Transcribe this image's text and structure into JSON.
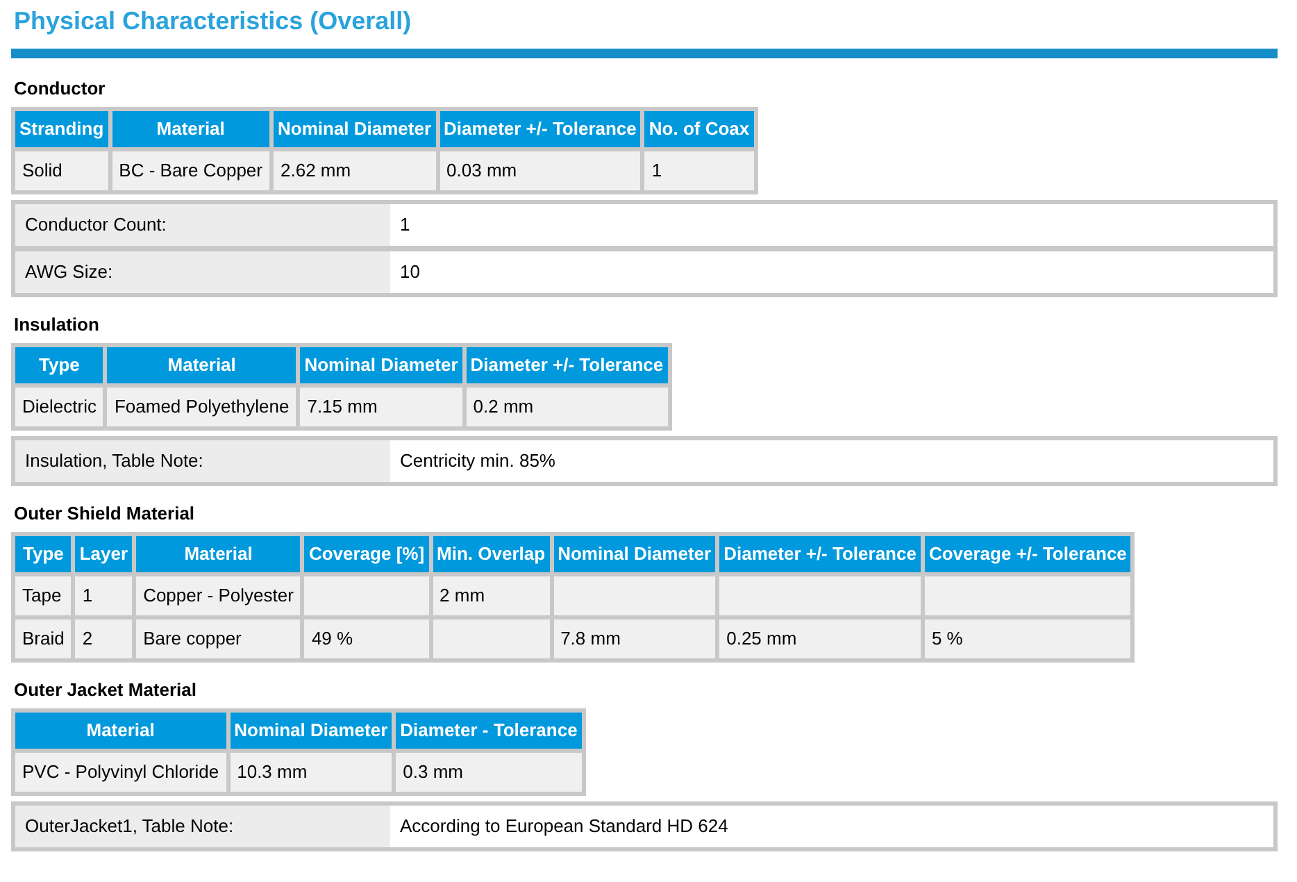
{
  "title": "Physical Characteristics (Overall)",
  "sections": [
    {
      "heading": "Conductor",
      "table": {
        "columns": [
          "Stranding",
          "Material",
          "Nominal Diameter",
          "Diameter +/- Tolerance",
          "No. of Coax"
        ],
        "rows": [
          [
            "Solid",
            "BC - Bare Copper",
            "2.62 mm",
            "0.03 mm",
            "1"
          ]
        ]
      },
      "properties": [
        {
          "label": "Conductor Count:",
          "value": "1"
        },
        {
          "label": "AWG Size:",
          "value": "10"
        }
      ]
    },
    {
      "heading": "Insulation",
      "table": {
        "columns": [
          "Type",
          "Material",
          "Nominal Diameter",
          "Diameter +/- Tolerance"
        ],
        "rows": [
          [
            "Dielectric",
            "Foamed Polyethylene",
            "7.15 mm",
            "0.2 mm"
          ]
        ]
      },
      "properties": [
        {
          "label": "Insulation, Table Note:",
          "value": "Centricity min. 85%"
        }
      ]
    },
    {
      "heading": "Outer Shield Material",
      "table": {
        "columns": [
          "Type",
          "Layer",
          "Material",
          "Coverage [%]",
          "Min. Overlap",
          "Nominal Diameter",
          "Diameter +/- Tolerance",
          "Coverage +/- Tolerance"
        ],
        "rows": [
          [
            "Tape",
            "1",
            "Copper - Polyester",
            null,
            "2 mm",
            null,
            null,
            null
          ],
          [
            "Braid",
            "2",
            "Bare copper",
            "49 %",
            null,
            "7.8 mm",
            "0.25 mm",
            "5 %"
          ]
        ]
      }
    },
    {
      "heading": "Outer Jacket Material",
      "table": {
        "columns": [
          "Material",
          "Nominal Diameter",
          "Diameter - Tolerance"
        ],
        "rows": [
          [
            "PVC - Polyvinyl Chloride",
            "10.3 mm",
            "0.3 mm"
          ]
        ]
      },
      "properties": [
        {
          "label": "OuterJacket1, Table Note:",
          "value": "According to European Standard HD 624"
        }
      ]
    }
  ]
}
